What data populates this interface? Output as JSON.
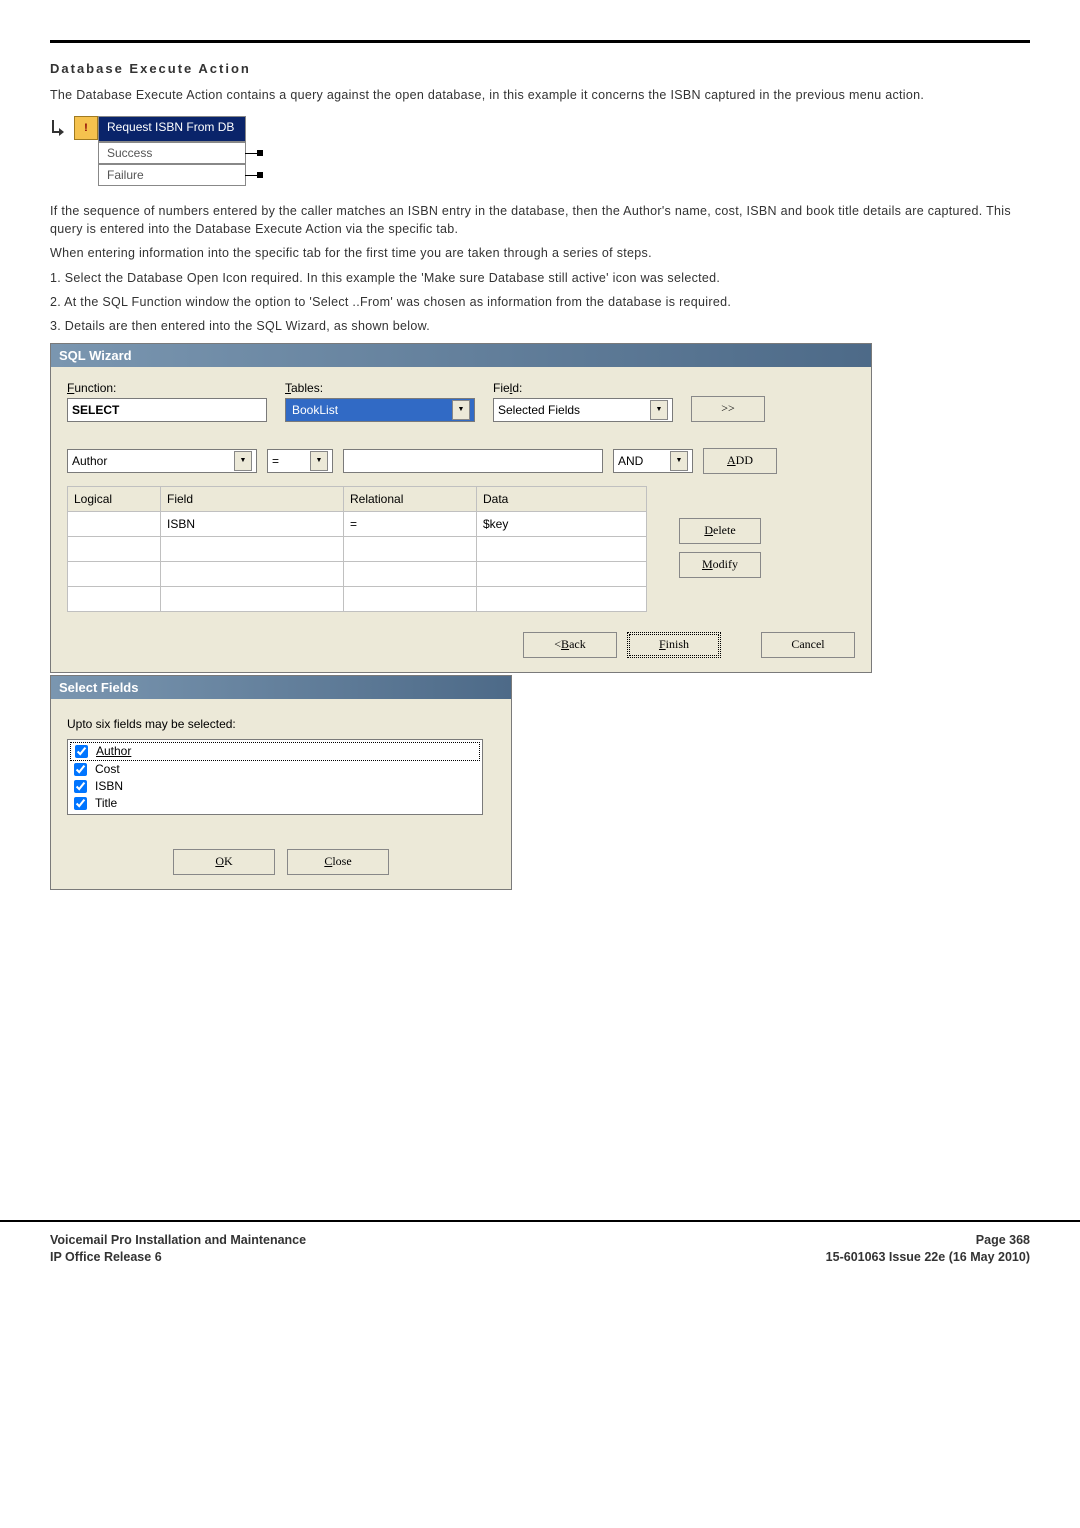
{
  "heading": "Database Execute Action",
  "intro": "The Database Execute Action contains a query against the open database, in this example it concerns the ISBN captured in the previous menu action.",
  "request_box": {
    "title": "Request ISBN From DB",
    "success": "Success",
    "failure": "Failure"
  },
  "para2": "If the sequence of numbers entered by the caller matches an ISBN entry in the database, then the Author's name, cost, ISBN and book title details are captured. This query is entered into the Database Execute Action via the specific tab.",
  "para3": "When entering information into the specific tab for the first time you are taken through a series of steps.",
  "steps": [
    "1. Select the Database Open Icon required. In this example the 'Make sure Database still active' icon was selected.",
    "2. At the SQL Function window the option to 'Select ..From' was chosen as information from the database is required.",
    "3. Details are then entered into the SQL Wizard, as shown below."
  ],
  "sql_wizard": {
    "title": "SQL Wizard",
    "labels": {
      "function": "Function:",
      "tables": "Tables:",
      "field": "Field:"
    },
    "function_value": "SELECT",
    "tables_value": "BookList",
    "field_value": "Selected Fields",
    "expand_btn": ">>",
    "cond_field": "Author",
    "cond_op": "=",
    "cond_logic": "AND",
    "add_btn": "ADD",
    "grid": {
      "headers": {
        "logical": "Logical",
        "field": "Field",
        "relational": "Relational",
        "data": "Data"
      },
      "rows": [
        {
          "logical": "",
          "field": "ISBN",
          "relational": "=",
          "data": "$key"
        }
      ]
    },
    "delete_btn": "Delete",
    "modify_btn": "Modify",
    "back_btn": "< Back",
    "finish_btn": "Finish",
    "cancel_btn": "Cancel"
  },
  "select_fields": {
    "title": "Select Fields",
    "instr": "Upto six fields may be selected:",
    "items": [
      {
        "label": "Author",
        "checked": true,
        "focused": true
      },
      {
        "label": "Cost",
        "checked": true,
        "focused": false
      },
      {
        "label": "ISBN",
        "checked": true,
        "focused": false
      },
      {
        "label": "Title",
        "checked": true,
        "focused": false
      }
    ],
    "ok_btn": "OK",
    "close_btn": "Close"
  },
  "footer": {
    "left1": "Voicemail Pro Installation and Maintenance",
    "left2": "IP Office Release 6",
    "right1": "Page 368",
    "right2": "15-601063 Issue 22e (16 May 2010)"
  }
}
